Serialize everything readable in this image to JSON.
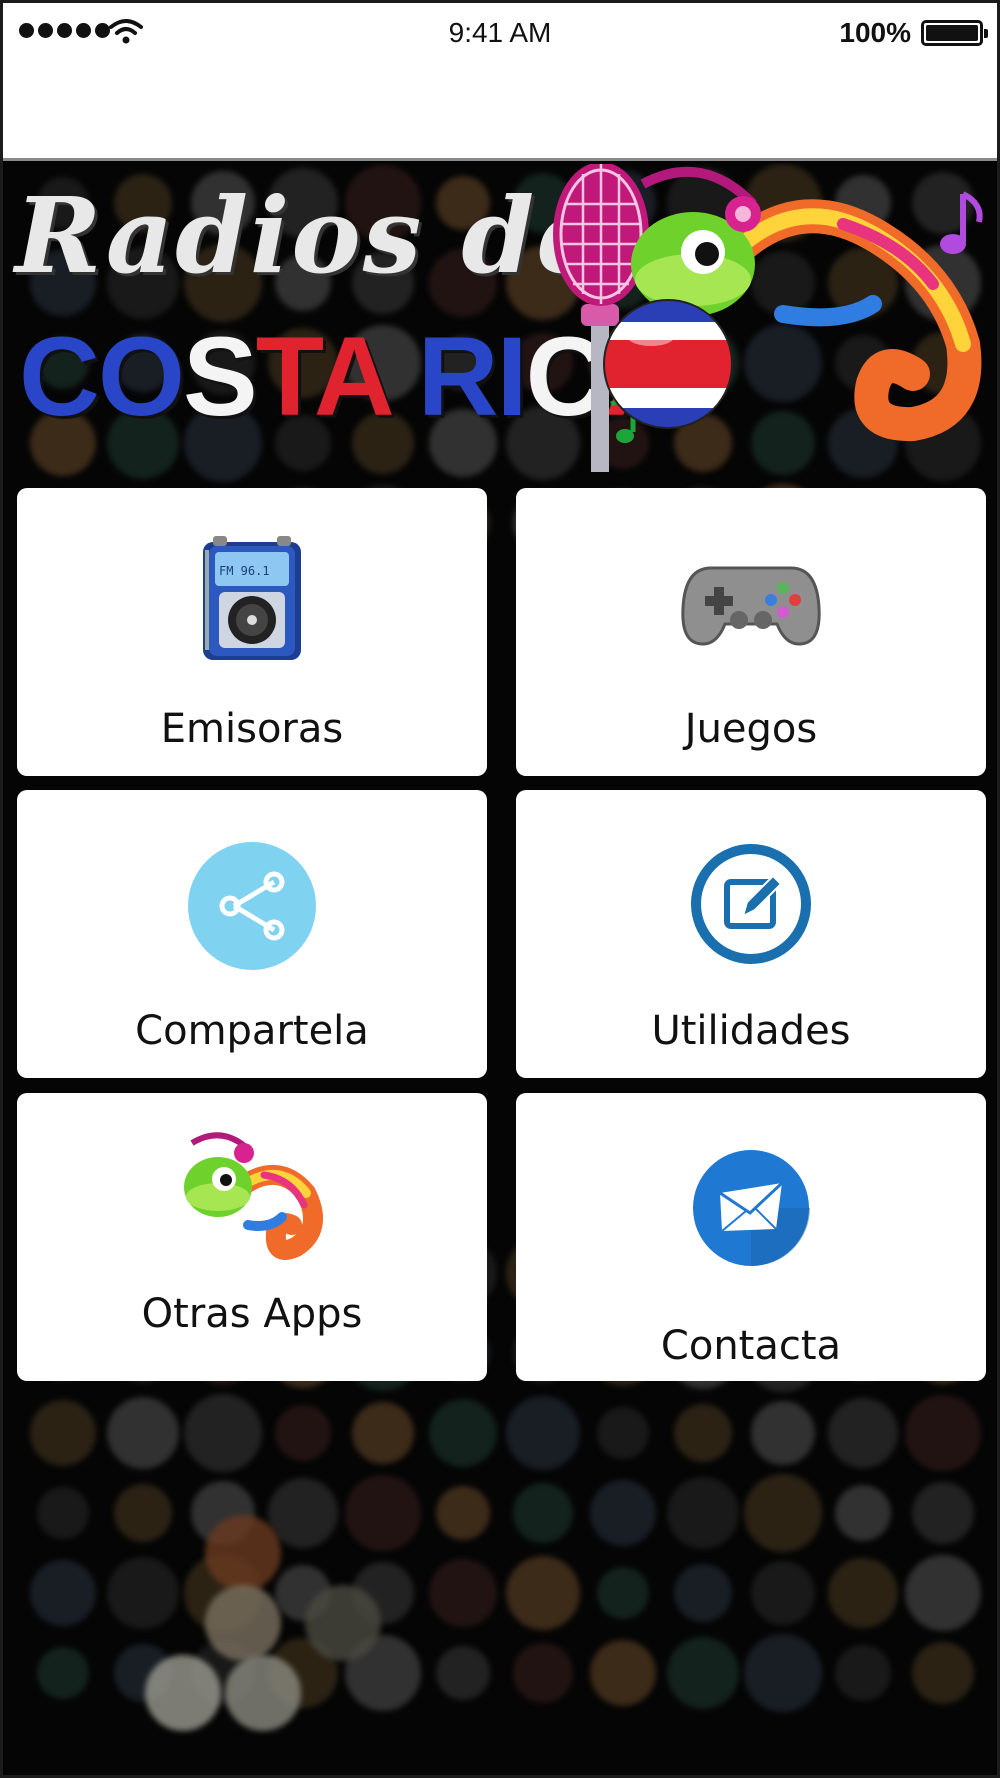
{
  "status_bar": {
    "signal_dots": 5,
    "time": "9:41 AM",
    "battery_percent": "100%",
    "icons": [
      "signal-icon",
      "wifi-icon",
      "battery-icon"
    ]
  },
  "banner": {
    "line1": "Radios de",
    "line2_parts": [
      {
        "text": "CO",
        "color": "#2a46c8"
      },
      {
        "text": "S",
        "color": "#f4f4f4"
      },
      {
        "text": "TA",
        "color": "#e0232e"
      },
      {
        "text": " ",
        "color": "#f4f4f4"
      },
      {
        "text": "RI",
        "color": "#2a46c8"
      },
      {
        "text": "C",
        "color": "#f4f4f4"
      },
      {
        "text": "A",
        "color": "#e0232e"
      }
    ],
    "icons": [
      "microphone-icon",
      "chameleon-icon",
      "costa-rica-flag-icon",
      "music-note-icon"
    ]
  },
  "menu": {
    "items": [
      {
        "label": "Emisoras",
        "icon": "radio-icon",
        "screen_text": "FM 96.1"
      },
      {
        "label": "Juegos",
        "icon": "gamepad-icon"
      },
      {
        "label": "Compartela",
        "icon": "share-icon"
      },
      {
        "label": "Utilidades",
        "icon": "edit-icon"
      },
      {
        "label": "Otras Apps",
        "icon": "chameleon-icon"
      },
      {
        "label": "Contacta",
        "icon": "mail-icon"
      }
    ]
  },
  "colors": {
    "background": "#050505",
    "tile": "#ffffff",
    "share_circle": "#7fd3f1",
    "utilities_ring": "#1a6faf",
    "mail_circle": "#1f78d1",
    "flag_blue": "#2a46c8",
    "flag_red": "#e0232e"
  }
}
